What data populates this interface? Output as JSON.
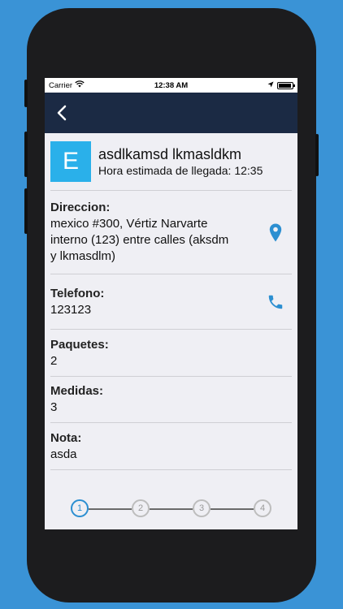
{
  "status_bar": {
    "carrier": "Carrier",
    "time": "12:38 AM"
  },
  "header": {
    "avatar_letter": "E",
    "name": "asdlkamsd lkmasldkm",
    "eta": "Hora estimada de llegada: 12:35"
  },
  "fields": {
    "direccion": {
      "label": "Direccion:",
      "value": "mexico #300, Vértiz Narvarte interno (123) entre calles (aksdm y lkmasdlm)"
    },
    "telefono": {
      "label": "Telefono:",
      "value": "123123"
    },
    "paquetes": {
      "label": "Paquetes:",
      "value": "2"
    },
    "medidas": {
      "label": "Medidas:",
      "value": "3"
    },
    "nota": {
      "label": "Nota:",
      "value": "asda"
    }
  },
  "stepper": {
    "steps": [
      "1",
      "2",
      "3",
      "4"
    ],
    "active_step": 1
  },
  "colors": {
    "background": "#3a93d6",
    "navbar": "#1b2a44",
    "avatar": "#2ab0ea",
    "accent": "#2c8fd1"
  }
}
